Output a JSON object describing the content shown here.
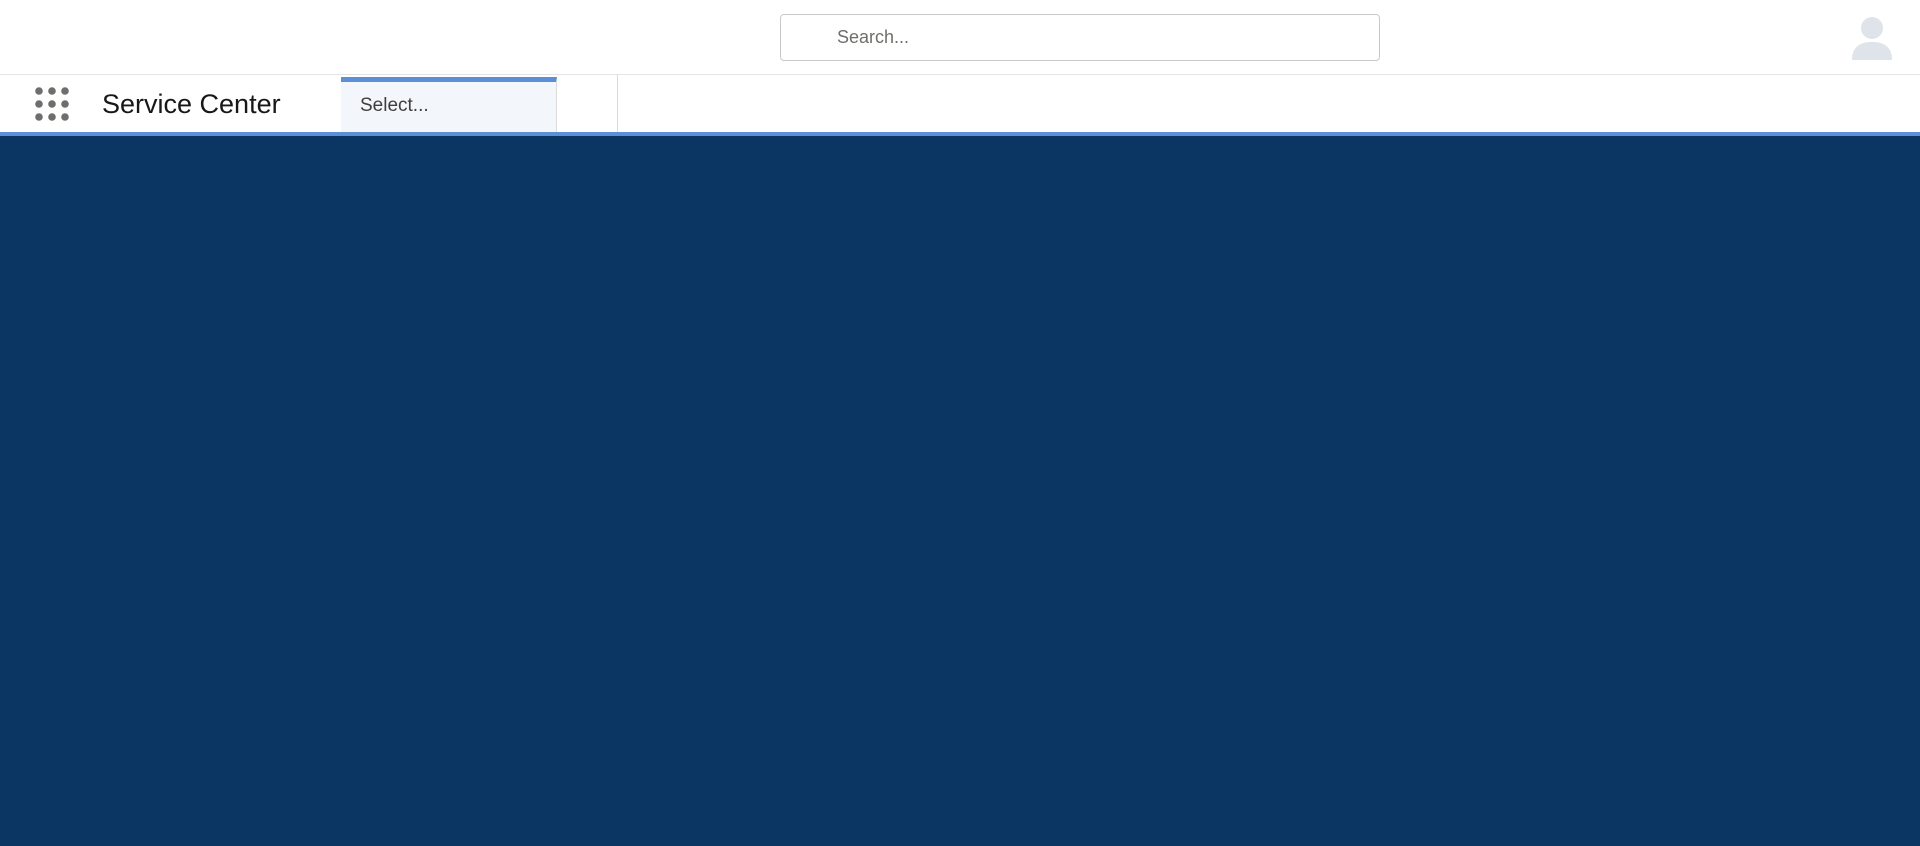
{
  "header": {
    "search": {
      "placeholder": "Search...",
      "value": "",
      "icon": "search-icon"
    },
    "avatar_icon": "user-avatar-icon"
  },
  "nav": {
    "app_launcher_icon": "app-launcher-grid-icon",
    "app_name": "Service Center",
    "selector_label": "Select..."
  },
  "colors": {
    "content_background": "#0b3563",
    "active_accent": "#5b8fd6"
  }
}
